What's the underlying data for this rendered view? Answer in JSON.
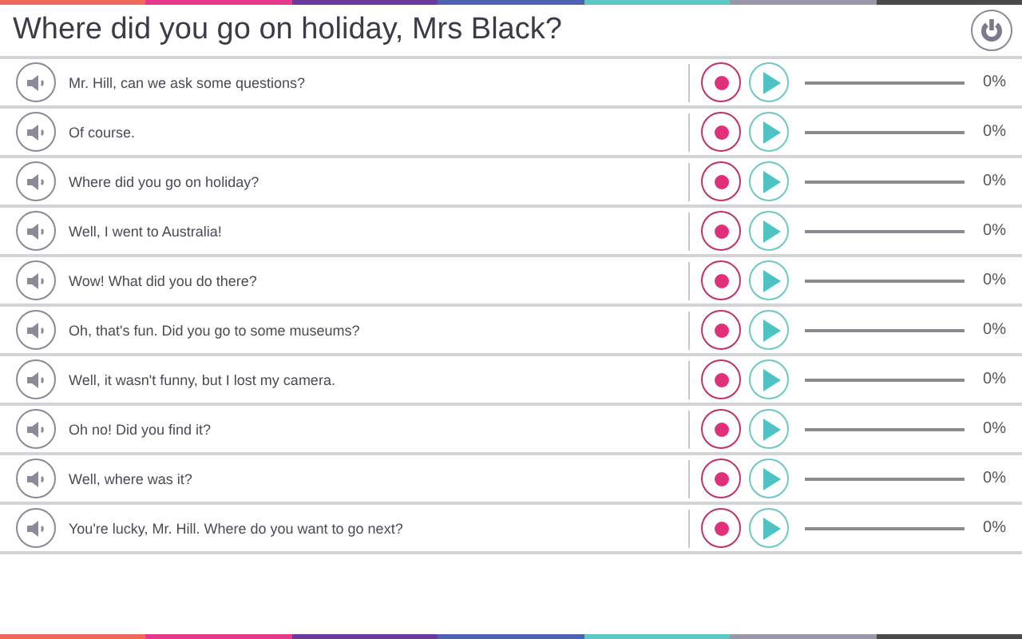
{
  "title": "Where did you go on holiday, Mrs Black?",
  "lines": [
    {
      "text": "Mr. Hill, can we ask some questions?",
      "level": 0,
      "reading": "0%"
    },
    {
      "text": "Of course.",
      "level": 0,
      "reading": "0%"
    },
    {
      "text": "Where did you go on holiday?",
      "level": 0,
      "reading": "0%"
    },
    {
      "text": "Well, I went to Australia!",
      "level": 0,
      "reading": "0%"
    },
    {
      "text": "Wow! What did you do there?",
      "level": 0,
      "reading": "0%"
    },
    {
      "text": "Oh, that's fun. Did you go to some museums?",
      "level": 0,
      "reading": "0%"
    },
    {
      "text": "Well, it wasn't funny, but I lost my camera.",
      "level": 0,
      "reading": "0%"
    },
    {
      "text": "Oh no! Did you find it?",
      "level": 0,
      "reading": "0%"
    },
    {
      "text": "Well, where was it?",
      "level": 0,
      "reading": "0%"
    },
    {
      "text": "You're lucky, Mr. Hill. Where do you want to go next?",
      "level": 0,
      "reading": "0%"
    }
  ]
}
